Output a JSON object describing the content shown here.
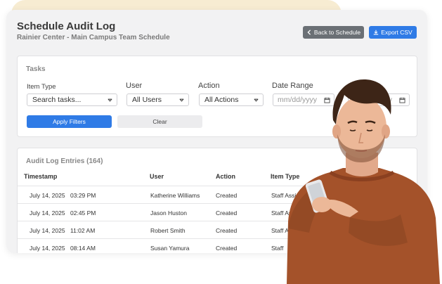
{
  "header": {
    "title": "Schedule Audit Log",
    "subtitle": "Rainier Center - Main Campus Team Schedule",
    "back_label": "Back to Schedule",
    "export_label": "Export CSV"
  },
  "filters": {
    "heading": "Tasks",
    "item_type_label": "Item Type",
    "item_type_value": "Search tasks...",
    "user_label": "User",
    "user_value": "All Users",
    "action_label": "Action",
    "action_value": "All Actions",
    "date_range_label": "Date Range",
    "date_placeholder": "mm/dd/yyyy",
    "apply_label": "Apply Filters",
    "clear_label": "Clear"
  },
  "log": {
    "heading": "Audit Log Entries (164)",
    "columns": [
      "Timestamp",
      "User",
      "Action",
      "Item Type"
    ],
    "rows": [
      {
        "date": "July 14, 2025",
        "time": "03:29 PM",
        "user": "Katherine Williams",
        "action": "Created",
        "item_type": "Staff Assi"
      },
      {
        "date": "July 14, 2025",
        "time": "02:45 PM",
        "user": "Jason Huston",
        "action": "Created",
        "item_type": "Staff Assi"
      },
      {
        "date": "July 14, 2025",
        "time": "11:02 AM",
        "user": "Robert Smith",
        "action": "Created",
        "item_type": "Staff As"
      },
      {
        "date": "July 14, 2025",
        "time": "08:14 AM",
        "user": "Susan Yamura",
        "action": "Created",
        "item_type": "Staff"
      }
    ]
  },
  "icons": {
    "back": "chevron-left-icon",
    "export": "download-icon",
    "dropdown": "chevron-down-icon",
    "calendar": "calendar-icon"
  },
  "colors": {
    "primary": "#2f7be6",
    "secondary_button": "#6b7075",
    "panel": "#f2f2f3",
    "sweater": "#a4522a"
  }
}
